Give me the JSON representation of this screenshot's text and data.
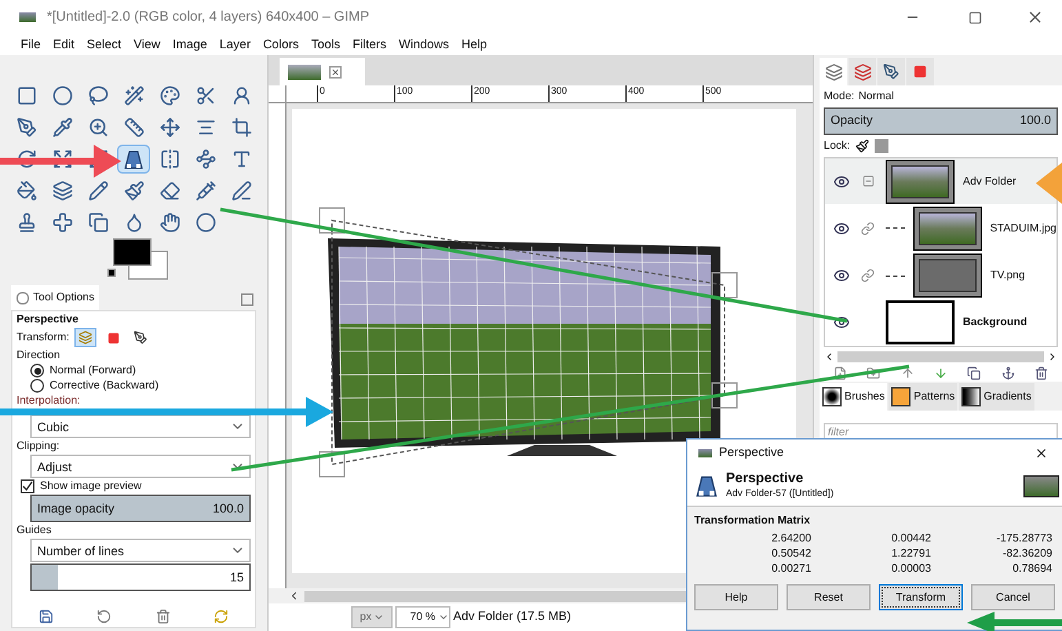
{
  "window": {
    "title": "*[Untitled]-2.0 (RGB color, 4 layers) 640x400 – GIMP"
  },
  "menu": [
    "File",
    "Edit",
    "Select",
    "View",
    "Image",
    "Layer",
    "Colors",
    "Tools",
    "Filters",
    "Windows",
    "Help"
  ],
  "toolbox": {
    "tools": [
      {
        "selected": false
      },
      {
        "selected": false
      },
      {
        "selected": false
      },
      {
        "selected": false
      },
      {
        "selected": false
      },
      {
        "selected": false
      },
      {
        "selected": false
      },
      {
        "selected": false
      },
      {
        "selected": false
      },
      {
        "selected": false
      },
      {
        "selected": false
      },
      {
        "selected": false
      },
      {
        "selected": false
      },
      {
        "selected": false
      },
      {
        "selected": false
      },
      {
        "selected": false
      },
      {
        "selected": false
      },
      {
        "selected": true
      },
      {
        "selected": false
      },
      {
        "selected": false
      },
      {
        "selected": false
      },
      {
        "selected": false
      },
      {
        "selected": false
      },
      {
        "selected": false
      },
      {
        "selected": false
      },
      {
        "selected": false
      },
      {
        "selected": false
      },
      {
        "selected": false
      },
      {
        "selected": false
      },
      {
        "selected": false
      },
      {
        "selected": false
      },
      {
        "selected": false
      },
      {
        "selected": false
      },
      {
        "selected": false
      }
    ]
  },
  "tool_options": {
    "tab": "Tool Options",
    "tool": "Perspective",
    "transform_label": "Transform:",
    "transform_modes": [
      {
        "selected": true
      },
      {
        "selected": false
      },
      {
        "selected": false
      }
    ],
    "direction_label": "Direction",
    "directions": [
      {
        "label": "Normal (Forward)",
        "selected": true
      },
      {
        "label": "Corrective (Backward)",
        "selected": false
      }
    ],
    "interpolation_label": "Interpolation:",
    "interpolation": "Cubic",
    "clipping_label": "Clipping:",
    "clipping": "Adjust",
    "show_preview": {
      "label": "Show image preview",
      "checked": true
    },
    "image_opacity": {
      "label": "Image opacity",
      "reading": "100.0",
      "level": 1
    },
    "guides_label": "Guides",
    "guides": "Number of lines",
    "guide_count": {
      "reading": "15",
      "level": 0.12
    }
  },
  "ruler_labels": [
    "0",
    "100",
    "200",
    "300",
    "400",
    "500"
  ],
  "status_bar": {
    "unit": "px",
    "zoom": "70 %",
    "info": "Adv Folder (17.5 MB)"
  },
  "layers_panel": {
    "tabs": [
      {
        "selected": true
      },
      {
        "selected": false
      },
      {
        "selected": false
      },
      {
        "selected": false
      }
    ],
    "mode_label": "Mode:",
    "mode": "Normal",
    "opacity": {
      "label": "Opacity",
      "reading": "100.0",
      "level": 1
    },
    "lock_label": "Lock:",
    "layers": [
      {
        "name": "Adv Folder",
        "kind": "group",
        "visible": true,
        "selected": true,
        "expanded": true,
        "children": [
          {
            "name": "STADUIM.jpg",
            "kind": "photo",
            "visible": true,
            "selected": false
          },
          {
            "name": "TV.png",
            "kind": "frame",
            "visible": true,
            "selected": false
          }
        ]
      },
      {
        "name": "Background",
        "kind": "blank",
        "visible": true,
        "selected": false
      }
    ]
  },
  "brushes_panel": {
    "tabs": [
      {
        "label": "Brushes",
        "selected": true
      },
      {
        "label": "Patterns",
        "selected": false
      },
      {
        "label": "Gradients",
        "selected": false
      }
    ],
    "filter_placeholder": "filter"
  },
  "dialog": {
    "title": "Perspective",
    "heading": "Perspective",
    "subtitle": "Adv Folder-57 ([Untitled])",
    "matrix_title": "Transformation Matrix",
    "matrix": [
      [
        "2.64200",
        "0.00442",
        "-175.28773"
      ],
      [
        "0.50542",
        "1.22791",
        "-82.36209"
      ],
      [
        "0.00271",
        "0.00003",
        "0.78694"
      ]
    ],
    "buttons": [
      {
        "label": "Help",
        "default": false
      },
      {
        "label": "Reset",
        "default": false
      },
      {
        "label": "Transform",
        "default": true
      },
      {
        "label": "Cancel",
        "default": false
      }
    ]
  }
}
